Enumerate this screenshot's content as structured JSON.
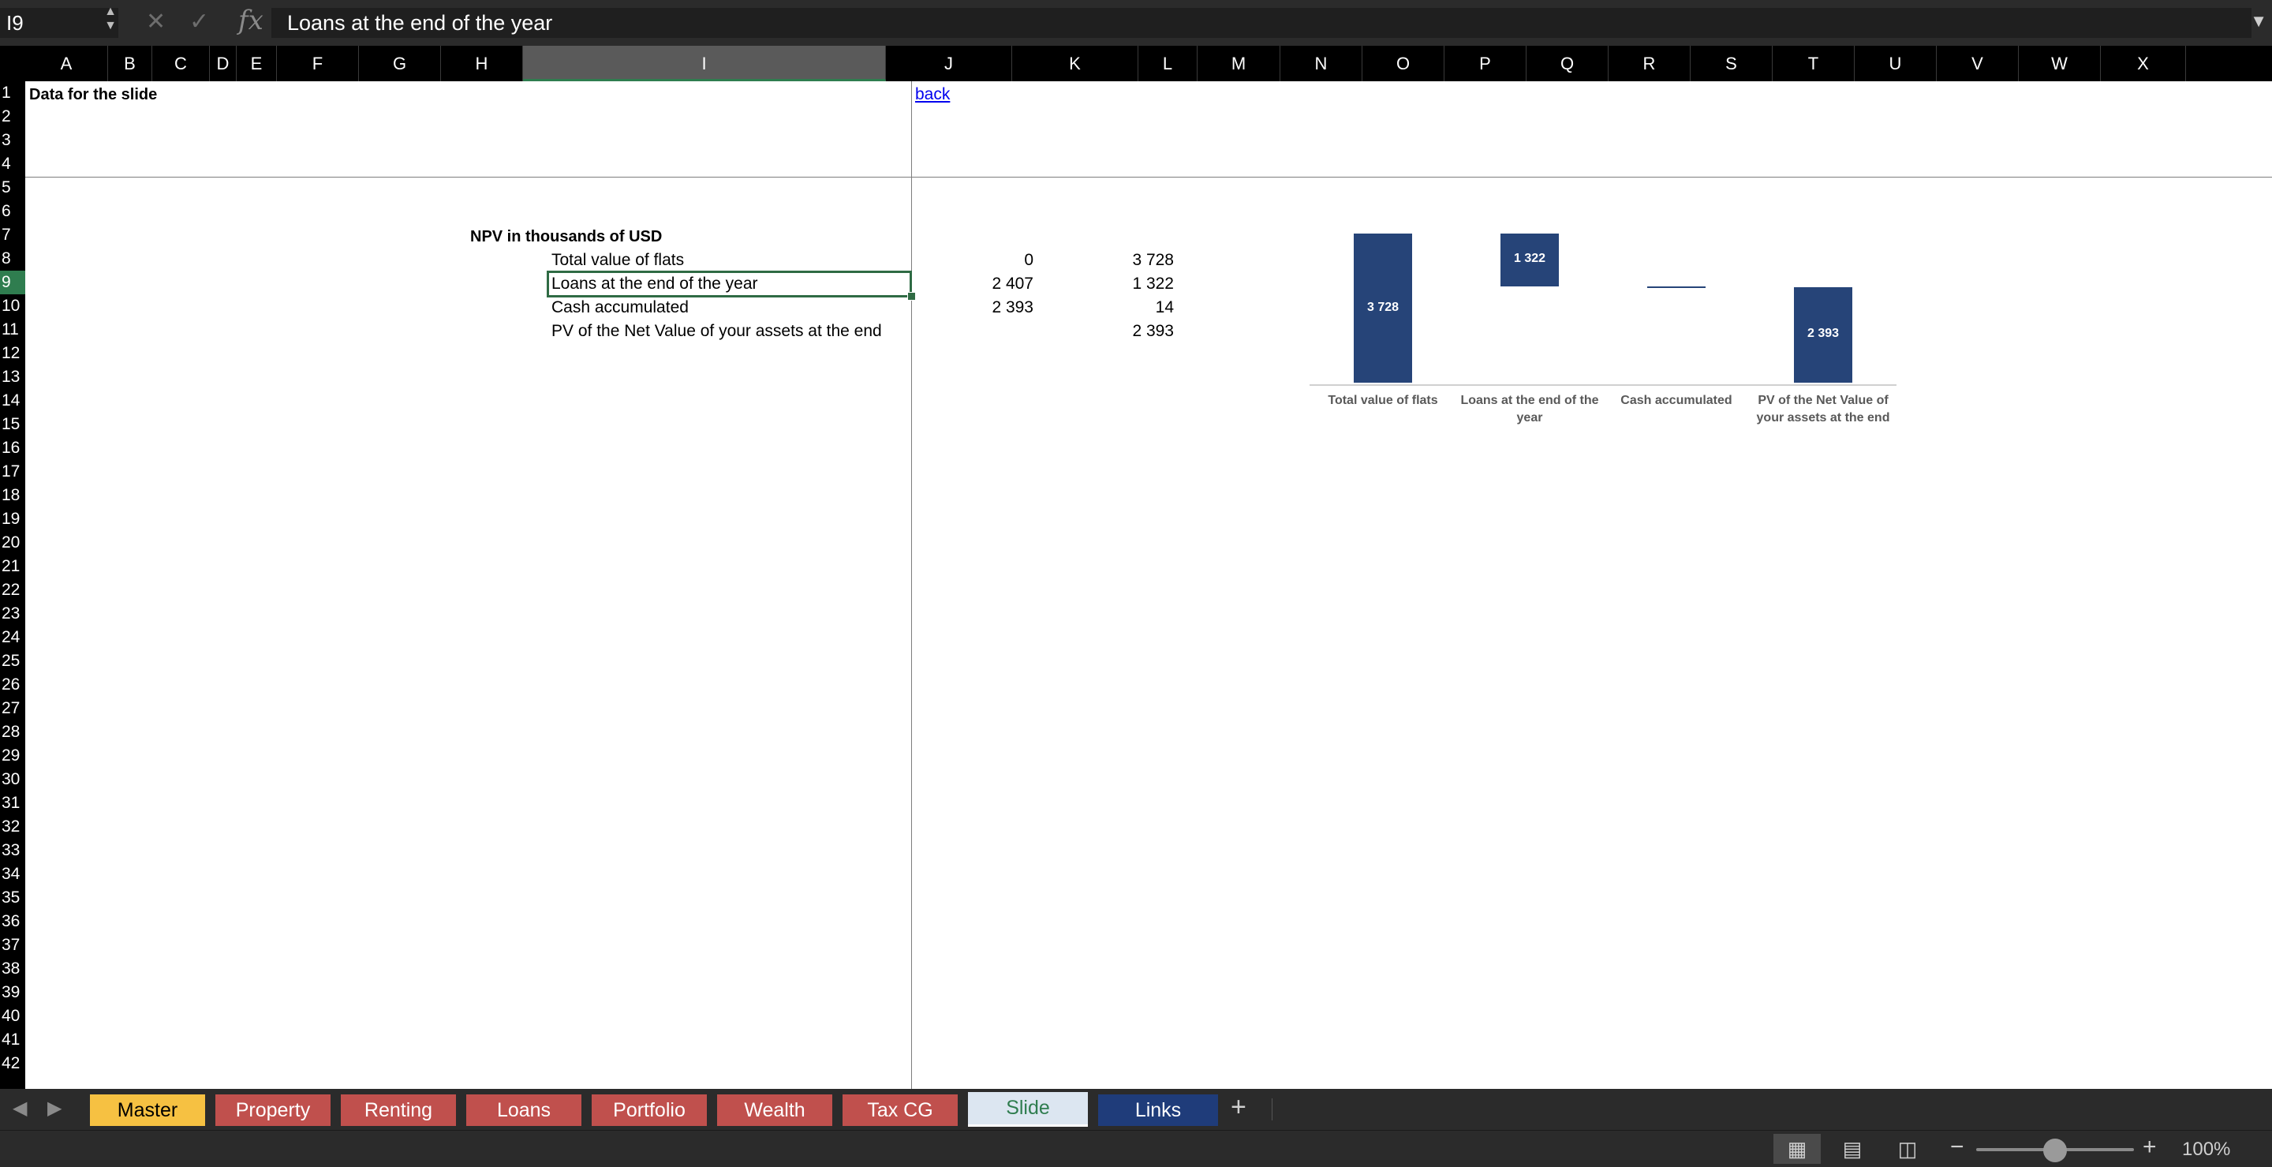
{
  "formula_bar": {
    "name_box": "I9",
    "cancel_icon": "close-icon",
    "confirm_icon": "check-icon",
    "fx_label": "fx",
    "formula": "Loans at the end of the year"
  },
  "columns": [
    "A",
    "B",
    "C",
    "D",
    "E",
    "F",
    "G",
    "H",
    "I",
    "J",
    "K",
    "L",
    "M",
    "N",
    "O",
    "P",
    "Q",
    "R",
    "S",
    "T",
    "U",
    "V",
    "W",
    "X"
  ],
  "selected_column": "I",
  "rows": [
    "1",
    "2",
    "3",
    "4",
    "5",
    "6",
    "7",
    "8",
    "9",
    "10",
    "11",
    "12",
    "13",
    "14",
    "15",
    "16",
    "17",
    "18",
    "19",
    "20",
    "21",
    "22",
    "23",
    "24",
    "25",
    "26",
    "27",
    "28",
    "29",
    "30",
    "31",
    "32",
    "33",
    "34",
    "35",
    "36",
    "37",
    "38",
    "39",
    "40",
    "41",
    "42"
  ],
  "selected_row": "9",
  "sheet": {
    "title": "Data for the slide",
    "back_link": "back",
    "table_title": "NPV in thousands of USD",
    "table_rows": [
      {
        "label": "Total value of flats",
        "j": "0",
        "k": "3 728"
      },
      {
        "label": "Loans at the end of the year",
        "j": "2 407",
        "k": "1 322"
      },
      {
        "label": "Cash accumulated",
        "j": "2 393",
        "k": "14"
      },
      {
        "label": "PV of the Net Value of your assets at the end",
        "j": "",
        "k": "2 393"
      }
    ]
  },
  "chart_data": {
    "type": "bar",
    "subtype": "waterfall",
    "categories": [
      "Total value of flats",
      "Loans at the end of the year",
      "Cash accumulated",
      "PV of the Net Value of your assets at the end"
    ],
    "base": [
      0,
      2407,
      2393,
      0
    ],
    "values": [
      3728,
      1322,
      14,
      2393
    ],
    "data_labels": [
      "3 728",
      "1 322",
      "",
      "2 393"
    ],
    "title": "",
    "xlabel": "",
    "ylabel": "",
    "ylim": [
      0,
      4000
    ],
    "grid": false,
    "legend": "none",
    "bar_color": "#264478"
  },
  "tabs": [
    {
      "label": "Master",
      "bg": "#f6c142",
      "color": "#000000"
    },
    {
      "label": "Property",
      "bg": "#c0504d",
      "color": "#ffffff"
    },
    {
      "label": "Renting",
      "bg": "#c0504d",
      "color": "#ffffff"
    },
    {
      "label": "Loans",
      "bg": "#c0504d",
      "color": "#ffffff"
    },
    {
      "label": "Portfolio",
      "bg": "#c0504d",
      "color": "#ffffff"
    },
    {
      "label": "Wealth",
      "bg": "#c0504d",
      "color": "#ffffff"
    },
    {
      "label": "Tax CG",
      "bg": "#c0504d",
      "color": "#ffffff"
    },
    {
      "label": "Slide",
      "bg": "#dce6f1",
      "color": "#2f7d4f",
      "active": true
    },
    {
      "label": "Links",
      "bg": "#1f3c7a",
      "color": "#ffffff"
    }
  ],
  "status": {
    "zoom": "100%",
    "zoom_fraction": 0.5
  }
}
